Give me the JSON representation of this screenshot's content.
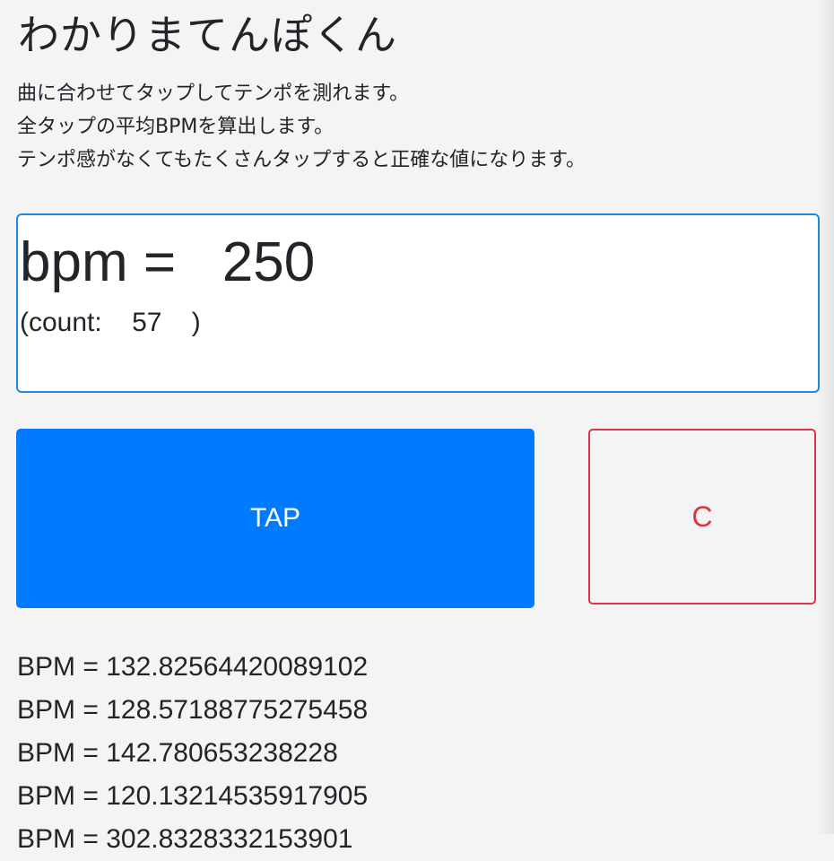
{
  "app": {
    "title": "わかりまてんぽくん",
    "description": [
      "曲に合わせてタップしてテンポを測れます。",
      "全タップの平均BPMを算出します。",
      "テンポ感がなくてもたくさんタップすると正確な値になります。"
    ]
  },
  "display": {
    "bpm_label": "bpm =",
    "bpm_value": "250",
    "count_prefix": "(count:",
    "count_value": "57",
    "count_suffix": ")"
  },
  "buttons": {
    "tap_label": "TAP",
    "clear_label": "C"
  },
  "log": [
    "BPM = 132.82564420089102",
    "BPM = 128.57188775275458",
    "BPM = 142.780653238228",
    "BPM = 120.13214535917905",
    "BPM = 302.8328332153901"
  ],
  "colors": {
    "primary": "#007bff",
    "danger": "#dc3545",
    "display_border": "#1e88e5",
    "background": "#f4f4f4",
    "text": "#212529"
  }
}
